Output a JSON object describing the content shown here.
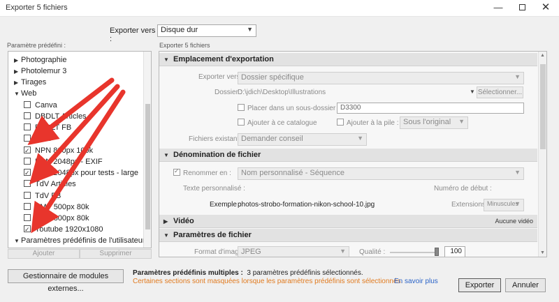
{
  "window": {
    "title": "Exporter 5 fichiers",
    "min": "—",
    "close": "✕"
  },
  "export_to": {
    "label": "Exporter vers :",
    "value": "Disque dur"
  },
  "preset_panel_label": "Paramètre prédéfini :",
  "export_count_label": "Exporter 5 fichiers",
  "presets": [
    {
      "label": "Photographie",
      "kind": "folder",
      "expanded": false
    },
    {
      "label": "Photolemur 3",
      "kind": "folder",
      "expanded": false
    },
    {
      "label": "Tirages",
      "kind": "folder",
      "expanded": false
    },
    {
      "label": "Web",
      "kind": "folder",
      "expanded": true
    },
    {
      "label": "Canva",
      "kind": "item",
      "checked": false
    },
    {
      "label": "DBDLT Articles",
      "kind": "item",
      "checked": false
    },
    {
      "label": "DBDLT FB",
      "kind": "item",
      "checked": false
    },
    {
      "label": "LCW",
      "kind": "item",
      "checked": false
    },
    {
      "label": "NPN 800px 100k",
      "kind": "item",
      "checked": true
    },
    {
      "label": "NPN 2048px - EXIF",
      "kind": "item",
      "checked": false
    },
    {
      "label": "NPN 2048px pour tests - large",
      "kind": "item",
      "checked": true
    },
    {
      "label": "TdV Articles",
      "kind": "item",
      "checked": false
    },
    {
      "label": "TdV FB",
      "kind": "item",
      "checked": false
    },
    {
      "label": "VMP 500px 80k",
      "kind": "item",
      "checked": false
    },
    {
      "label": "VMP 800px 80k",
      "kind": "item",
      "checked": false
    },
    {
      "label": "Youtube 1920x1080",
      "kind": "item",
      "checked": true
    },
    {
      "label": "Paramètres prédéfinis de l'utilisateur",
      "kind": "folder",
      "expanded": true
    }
  ],
  "preset_buttons": {
    "add": "Ajouter",
    "remove": "Supprimer"
  },
  "sections": {
    "location": {
      "title": "Emplacement d'exportation",
      "export_to_label": "Exporter vers :",
      "export_to_value": "Dossier spécifique",
      "folder_label": "Dossier :",
      "folder_path": "D:\\jdich\\Desktop\\Illustrations",
      "select_button": "Sélectionner...",
      "subfolder_label": "Placer dans un sous-dossier :",
      "subfolder_value": "D3300",
      "add_catalog_label": "Ajouter à ce catalogue",
      "add_stack_label": "Ajouter à la pile :",
      "stack_value": "Sous l'original",
      "existing_label": "Fichiers existants :",
      "existing_value": "Demander conseil"
    },
    "naming": {
      "title": "Dénomination de fichier",
      "rename_label": "Renommer en :",
      "rename_value": "Nom personnalisé - Séquence",
      "custom_text_label": "Texte personnalisé :",
      "start_number_label": "Numéro de début :",
      "example_label": "Exemple :",
      "example_value": "photos-strobo-formation-nikon-school-10.jpg",
      "extensions_label": "Extensions :",
      "extensions_value": "Minuscules"
    },
    "video": {
      "title": "Vidéo",
      "status": "Aucune vidéo"
    },
    "file_settings": {
      "title": "Paramètres de fichier",
      "format_label": "Format d'image :",
      "format_value": "JPEG",
      "quality_label": "Qualité :",
      "quality_value": "100",
      "quality_fraction": 1.0
    }
  },
  "footer": {
    "module_manager": "Gestionnaire de modules externes...",
    "multi_label": "Paramètres prédéfinis multiples :",
    "multi_value": "3 paramètres prédéfinis sélectionnés.",
    "warning": "Certaines sections sont masquées lorsque les paramètres prédéfinis sont sélectionnés.",
    "learn_more": "En savoir plus",
    "export": "Exporter",
    "cancel": "Annuler"
  },
  "colors": {
    "arrow": "#e8352c",
    "warning": "#e07a1f",
    "link": "#2a63c8"
  }
}
